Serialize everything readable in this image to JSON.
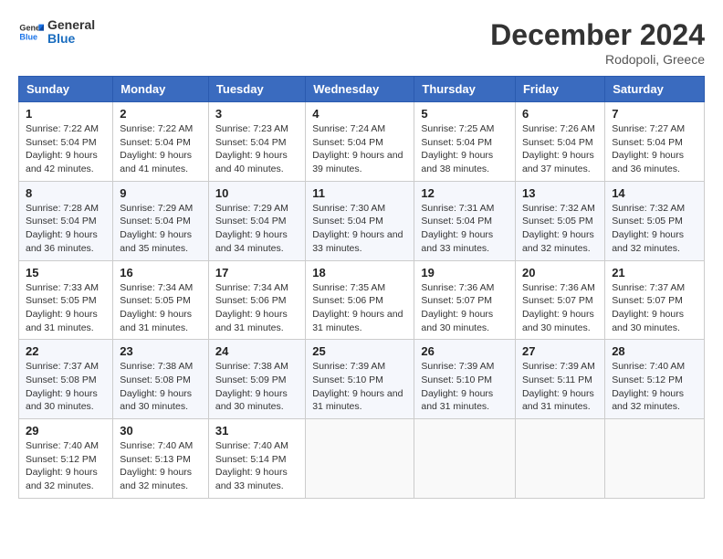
{
  "header": {
    "logo_line1": "General",
    "logo_line2": "Blue",
    "month": "December 2024",
    "location": "Rodopoli, Greece"
  },
  "weekdays": [
    "Sunday",
    "Monday",
    "Tuesday",
    "Wednesday",
    "Thursday",
    "Friday",
    "Saturday"
  ],
  "weeks": [
    [
      {
        "day": "1",
        "sunrise": "7:22 AM",
        "sunset": "5:04 PM",
        "daylight": "9 hours and 42 minutes."
      },
      {
        "day": "2",
        "sunrise": "7:22 AM",
        "sunset": "5:04 PM",
        "daylight": "9 hours and 41 minutes."
      },
      {
        "day": "3",
        "sunrise": "7:23 AM",
        "sunset": "5:04 PM",
        "daylight": "9 hours and 40 minutes."
      },
      {
        "day": "4",
        "sunrise": "7:24 AM",
        "sunset": "5:04 PM",
        "daylight": "9 hours and 39 minutes."
      },
      {
        "day": "5",
        "sunrise": "7:25 AM",
        "sunset": "5:04 PM",
        "daylight": "9 hours and 38 minutes."
      },
      {
        "day": "6",
        "sunrise": "7:26 AM",
        "sunset": "5:04 PM",
        "daylight": "9 hours and 37 minutes."
      },
      {
        "day": "7",
        "sunrise": "7:27 AM",
        "sunset": "5:04 PM",
        "daylight": "9 hours and 36 minutes."
      }
    ],
    [
      {
        "day": "8",
        "sunrise": "7:28 AM",
        "sunset": "5:04 PM",
        "daylight": "9 hours and 36 minutes."
      },
      {
        "day": "9",
        "sunrise": "7:29 AM",
        "sunset": "5:04 PM",
        "daylight": "9 hours and 35 minutes."
      },
      {
        "day": "10",
        "sunrise": "7:29 AM",
        "sunset": "5:04 PM",
        "daylight": "9 hours and 34 minutes."
      },
      {
        "day": "11",
        "sunrise": "7:30 AM",
        "sunset": "5:04 PM",
        "daylight": "9 hours and 33 minutes."
      },
      {
        "day": "12",
        "sunrise": "7:31 AM",
        "sunset": "5:04 PM",
        "daylight": "9 hours and 33 minutes."
      },
      {
        "day": "13",
        "sunrise": "7:32 AM",
        "sunset": "5:05 PM",
        "daylight": "9 hours and 32 minutes."
      },
      {
        "day": "14",
        "sunrise": "7:32 AM",
        "sunset": "5:05 PM",
        "daylight": "9 hours and 32 minutes."
      }
    ],
    [
      {
        "day": "15",
        "sunrise": "7:33 AM",
        "sunset": "5:05 PM",
        "daylight": "9 hours and 31 minutes."
      },
      {
        "day": "16",
        "sunrise": "7:34 AM",
        "sunset": "5:05 PM",
        "daylight": "9 hours and 31 minutes."
      },
      {
        "day": "17",
        "sunrise": "7:34 AM",
        "sunset": "5:06 PM",
        "daylight": "9 hours and 31 minutes."
      },
      {
        "day": "18",
        "sunrise": "7:35 AM",
        "sunset": "5:06 PM",
        "daylight": "9 hours and 31 minutes."
      },
      {
        "day": "19",
        "sunrise": "7:36 AM",
        "sunset": "5:07 PM",
        "daylight": "9 hours and 30 minutes."
      },
      {
        "day": "20",
        "sunrise": "7:36 AM",
        "sunset": "5:07 PM",
        "daylight": "9 hours and 30 minutes."
      },
      {
        "day": "21",
        "sunrise": "7:37 AM",
        "sunset": "5:07 PM",
        "daylight": "9 hours and 30 minutes."
      }
    ],
    [
      {
        "day": "22",
        "sunrise": "7:37 AM",
        "sunset": "5:08 PM",
        "daylight": "9 hours and 30 minutes."
      },
      {
        "day": "23",
        "sunrise": "7:38 AM",
        "sunset": "5:08 PM",
        "daylight": "9 hours and 30 minutes."
      },
      {
        "day": "24",
        "sunrise": "7:38 AM",
        "sunset": "5:09 PM",
        "daylight": "9 hours and 30 minutes."
      },
      {
        "day": "25",
        "sunrise": "7:39 AM",
        "sunset": "5:10 PM",
        "daylight": "9 hours and 31 minutes."
      },
      {
        "day": "26",
        "sunrise": "7:39 AM",
        "sunset": "5:10 PM",
        "daylight": "9 hours and 31 minutes."
      },
      {
        "day": "27",
        "sunrise": "7:39 AM",
        "sunset": "5:11 PM",
        "daylight": "9 hours and 31 minutes."
      },
      {
        "day": "28",
        "sunrise": "7:40 AM",
        "sunset": "5:12 PM",
        "daylight": "9 hours and 32 minutes."
      }
    ],
    [
      {
        "day": "29",
        "sunrise": "7:40 AM",
        "sunset": "5:12 PM",
        "daylight": "9 hours and 32 minutes."
      },
      {
        "day": "30",
        "sunrise": "7:40 AM",
        "sunset": "5:13 PM",
        "daylight": "9 hours and 32 minutes."
      },
      {
        "day": "31",
        "sunrise": "7:40 AM",
        "sunset": "5:14 PM",
        "daylight": "9 hours and 33 minutes."
      },
      null,
      null,
      null,
      null
    ]
  ],
  "labels": {
    "sunrise": "Sunrise:",
    "sunset": "Sunset:",
    "daylight": "Daylight:"
  }
}
